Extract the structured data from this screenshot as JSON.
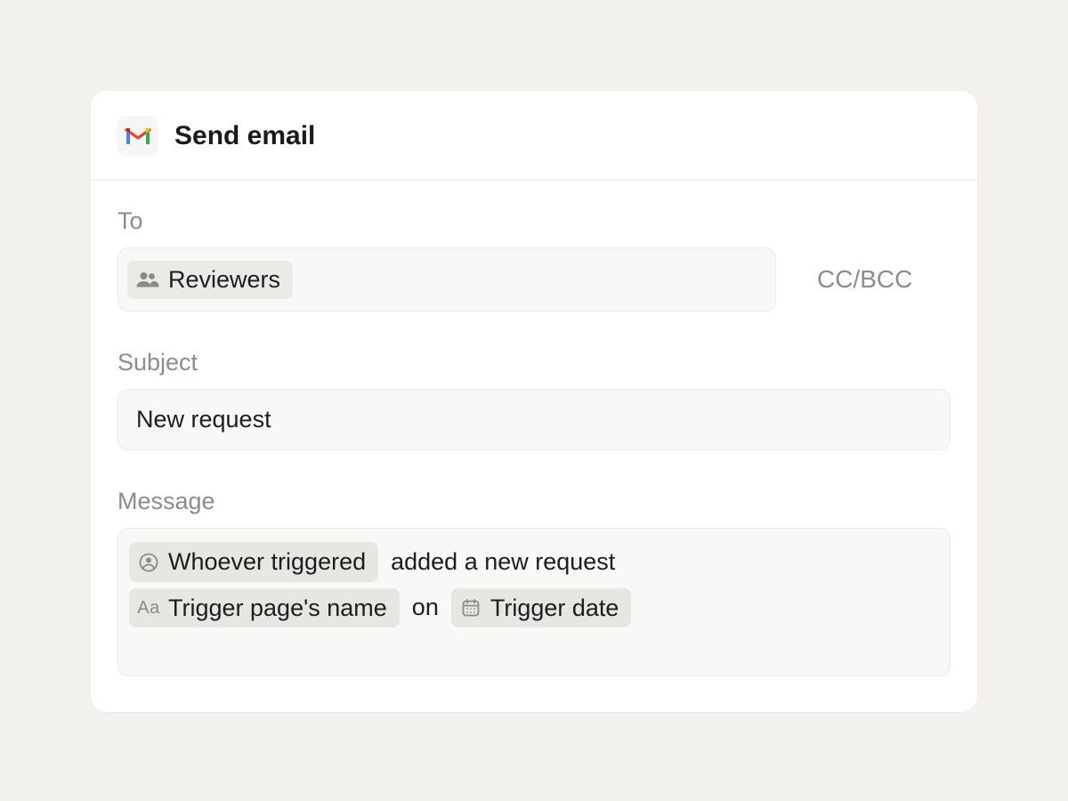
{
  "header": {
    "title": "Send email"
  },
  "fields": {
    "to": {
      "label": "To",
      "chip": "Reviewers",
      "ccbcc": "CC/BCC"
    },
    "subject": {
      "label": "Subject",
      "value": "New request"
    },
    "message": {
      "label": "Message",
      "tokens": {
        "who": "Whoever triggered",
        "text_after_who": "added a new request",
        "page_name": "Trigger page's name",
        "text_on": "on",
        "date": "Trigger date"
      },
      "token_icons": {
        "text_type": "Aa"
      }
    }
  }
}
